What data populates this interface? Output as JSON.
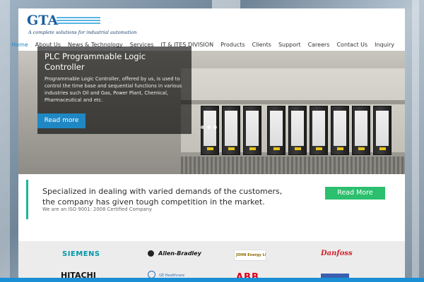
{
  "brand": {
    "logo_text": "GTA",
    "tagline": "A complete solutions for industrial automation"
  },
  "nav": {
    "items": [
      {
        "label": "Home",
        "active": true
      },
      {
        "label": "About Us"
      },
      {
        "label": "News & Technology"
      },
      {
        "label": "Services"
      },
      {
        "label": "IT & ITES DIVISION"
      },
      {
        "label": "Products"
      },
      {
        "label": "Clients"
      },
      {
        "label": "Support"
      },
      {
        "label": "Careers"
      },
      {
        "label": "Contact Us"
      },
      {
        "label": "Inquiry"
      }
    ]
  },
  "hero": {
    "title": "PLC Programmable Logic Controller",
    "body": "Programmable Logic Controller, offered by us, is used to control the time base and sequential functions in various industries such Oil and Gas, Power Plant, Chemical, Pharmaceutical and etc.",
    "button_label": "Read more"
  },
  "callout": {
    "headline": "Specialized in dealing with varied demands of the customers, the company has given tough competition in the market.",
    "subtext": "We are an ISO 9001: 2008 Certified Company",
    "button_label": "Read More"
  },
  "clients": {
    "logos": [
      {
        "name": "SIEMENS",
        "color": "#0098a6"
      },
      {
        "name": "Allen-Bradley",
        "color": "#111111"
      },
      {
        "name": "JOHN Energy Ltd.",
        "color": "#8a6a00"
      },
      {
        "name": "Danfoss",
        "color": "#d0202a"
      },
      {
        "name": "HITACHI",
        "color": "#111111"
      },
      {
        "name": "GE Healthcare",
        "color": "#2a6fb8"
      },
      {
        "name": "ABB",
        "color": "#e2001a"
      }
    ]
  },
  "colors": {
    "accent": "#1f88c4",
    "cta": "#2cbf6e",
    "callout_border": "#1eb59a"
  }
}
